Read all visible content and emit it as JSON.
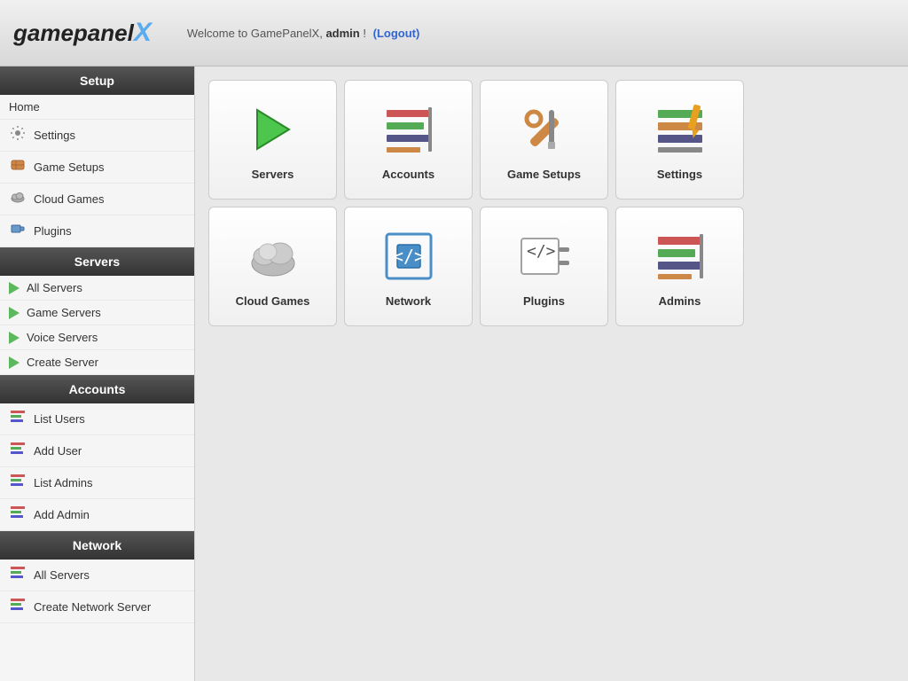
{
  "header": {
    "logo_game": "game",
    "logo_panel": "panel",
    "logo_x": "X",
    "welcome_prefix": "Welcome to GamePanelX,",
    "admin_name": "admin",
    "welcome_suffix": "!",
    "logout_label": "(Logout)"
  },
  "sidebar": {
    "setup_header": "Setup",
    "home_label": "Home",
    "setup_items": [
      {
        "label": "Settings",
        "icon": "settings"
      },
      {
        "label": "Game Setups",
        "icon": "gamesetups"
      },
      {
        "label": "Cloud Games",
        "icon": "cloudgames"
      },
      {
        "label": "Plugins",
        "icon": "plugins"
      }
    ],
    "servers_header": "Servers",
    "server_items": [
      {
        "label": "All Servers",
        "icon": "play"
      },
      {
        "label": "Game Servers",
        "icon": "play"
      },
      {
        "label": "Voice Servers",
        "icon": "play"
      },
      {
        "label": "Create Server",
        "icon": "play"
      }
    ],
    "accounts_header": "Accounts",
    "account_items": [
      {
        "label": "List Users",
        "icon": "user"
      },
      {
        "label": "Add User",
        "icon": "user"
      },
      {
        "label": "List Admins",
        "icon": "user"
      },
      {
        "label": "Add Admin",
        "icon": "user"
      }
    ],
    "network_header": "Network",
    "network_items": [
      {
        "label": "All Servers",
        "icon": "network"
      },
      {
        "label": "Create Network Server",
        "icon": "network"
      }
    ]
  },
  "tiles": [
    {
      "id": "servers",
      "label": "Servers",
      "icon": "servers"
    },
    {
      "id": "accounts",
      "label": "Accounts",
      "icon": "accounts"
    },
    {
      "id": "gamesetups",
      "label": "Game Setups",
      "icon": "gamesetups"
    },
    {
      "id": "settings",
      "label": "Settings",
      "icon": "settings"
    },
    {
      "id": "cloudgames",
      "label": "Cloud Games",
      "icon": "cloudgames"
    },
    {
      "id": "network",
      "label": "Network",
      "icon": "network"
    },
    {
      "id": "plugins",
      "label": "Plugins",
      "icon": "plugins"
    },
    {
      "id": "admins",
      "label": "Admins",
      "icon": "admins"
    }
  ]
}
